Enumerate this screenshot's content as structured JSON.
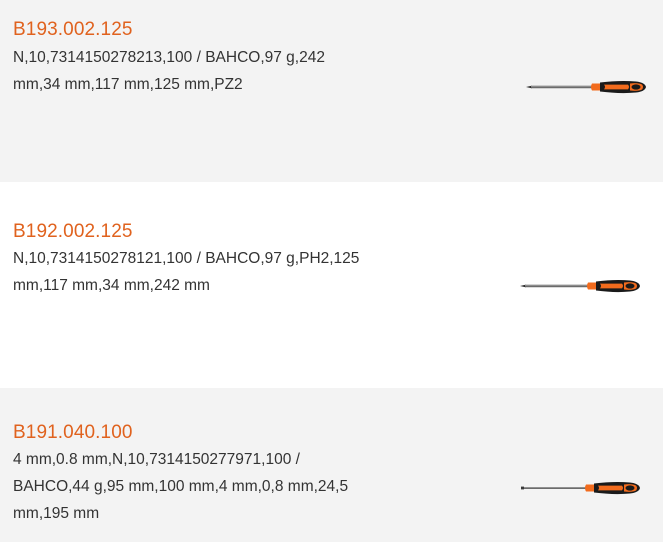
{
  "colors": {
    "accent": "#e0621e",
    "text": "#333333",
    "row_alt_bg": "#f3f3f3",
    "handle_black": "#1a1a1a",
    "handle_orange": "#f26b1d",
    "shaft": "#6b6b6b"
  },
  "products": [
    {
      "code": "B193.002.125",
      "specs": "N,10,7314150278213,100 / BAHCO,97 g,242 mm,34 mm,117 mm,125 mm,PZ2",
      "image_icon": "screwdriver-icon"
    },
    {
      "code": "B192.002.125",
      "specs": "N,10,7314150278121,100 / BAHCO,97 g,PH2,125 mm,117 mm,34 mm,242 mm",
      "image_icon": "screwdriver-icon"
    },
    {
      "code": "B191.040.100",
      "specs": "4 mm,0.8 mm,N,10,7314150277971,100 / BAHCO,44 g,95 mm,100 mm,4 mm,0,8 mm,24,5 mm,195 mm",
      "image_icon": "screwdriver-icon"
    }
  ]
}
